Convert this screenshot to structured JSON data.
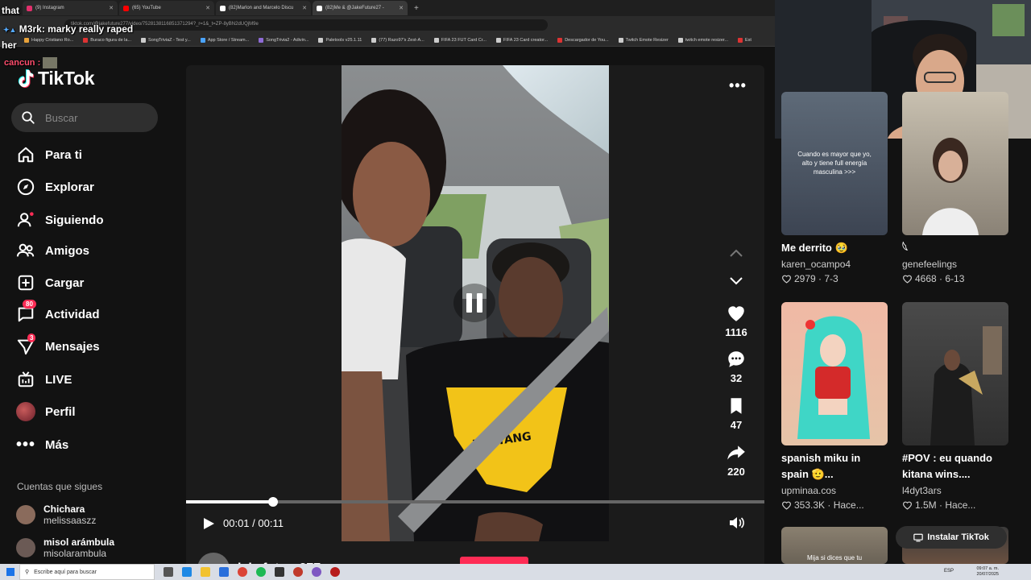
{
  "browser": {
    "tabs": [
      {
        "title": "(9) Instagram",
        "color": "#e1306c"
      },
      {
        "title": "(65) YouTube",
        "color": "#ff0000"
      },
      {
        "title": "(82)Marlon and Marcelo Discu",
        "color": "#ffffff"
      },
      {
        "title": "(82)Me & @JakeFuture27 -",
        "color": "#ffffff"
      }
    ],
    "url": "tiktok.com/@jakefuture277/video/7528138116851371294?_r=1&_t=ZP-8yBN2dUQjM9e",
    "bookmarks": [
      "Happy Cristiano Ro...",
      "Buraco figura de la...",
      "SongTriviaZ - Test y...",
      "App Store / Stream...",
      "SongTrivia2 - Adivin...",
      "Paletools v25.1.11",
      "(77) Razo97's Zest-A...",
      "FIFA 23 FUT Card Cr...",
      "FIFA 23 Card creator...",
      "Descargador de You...",
      "Twitch Emote Resizer",
      "twitch emote resizer...",
      "Est"
    ]
  },
  "chat": {
    "line1": "that",
    "line2_user": "M3rk",
    "line2_msg": ": marky really raped",
    "line3": "her",
    "line4_user": "cancun :"
  },
  "sidebar": {
    "logo": "TikTok",
    "search_placeholder": "Buscar",
    "nav": [
      {
        "label": "Para ti",
        "icon": "home-icon"
      },
      {
        "label": "Explorar",
        "icon": "compass-icon"
      },
      {
        "label": "Siguiendo",
        "icon": "following-icon"
      },
      {
        "label": "Amigos",
        "icon": "friends-icon"
      },
      {
        "label": "Cargar",
        "icon": "upload-icon"
      },
      {
        "label": "Actividad",
        "icon": "inbox-icon",
        "badge": "80"
      },
      {
        "label": "Mensajes",
        "icon": "send-icon",
        "badge": "3"
      },
      {
        "label": "LIVE",
        "icon": "live-icon"
      },
      {
        "label": "Perfil",
        "icon": "profile-icon"
      },
      {
        "label": "Más",
        "icon": "more-icon"
      }
    ],
    "following_heading": "Cuentas que sigues",
    "following": [
      {
        "name": "Chichara",
        "handle": "melissaaszz"
      },
      {
        "name": "misol arámbula",
        "handle": "misolarambula"
      }
    ]
  },
  "player": {
    "likes": "1116",
    "comments": "32",
    "saves": "47",
    "shares": "220",
    "time": "00:01 / 00:11",
    "progress": 0.15,
    "author": "jakefuture277",
    "shirt_text": "WU-TANG"
  },
  "grid": [
    {
      "overlay": "Cuando es mayor que yo,\nalto y tiene full energía\nmasculina >>>",
      "title": "Me derrito 🥹",
      "user": "karen_ocampo4",
      "likes": "2979",
      "date": "7-3"
    },
    {
      "overlay": "",
      "title": "𓆩",
      "user": "genefeelings",
      "likes": "4668",
      "date": "6-13"
    },
    {
      "overlay": "",
      "title": "spanish miku in spain 🫡...",
      "user": "upminaa.cos",
      "likes": "353.3K",
      "date": "Hace..."
    },
    {
      "overlay": "",
      "title": "#POV : eu quando kitana wins....",
      "user": "l4dyt3ars",
      "likes": "1.5M",
      "date": "Hace..."
    },
    {
      "overlay": "Mija si dices que tu",
      "title": "",
      "user": "",
      "likes": "",
      "date": ""
    }
  ],
  "install_label": "Instalar TikTok",
  "taskbar": {
    "search_placeholder": "Escribe aquí para buscar",
    "lang": "ESP",
    "time": "09:07 a. m.",
    "date": "20/07/2025"
  },
  "colors": {
    "accent": "#fe2c55",
    "background": "#121212"
  }
}
